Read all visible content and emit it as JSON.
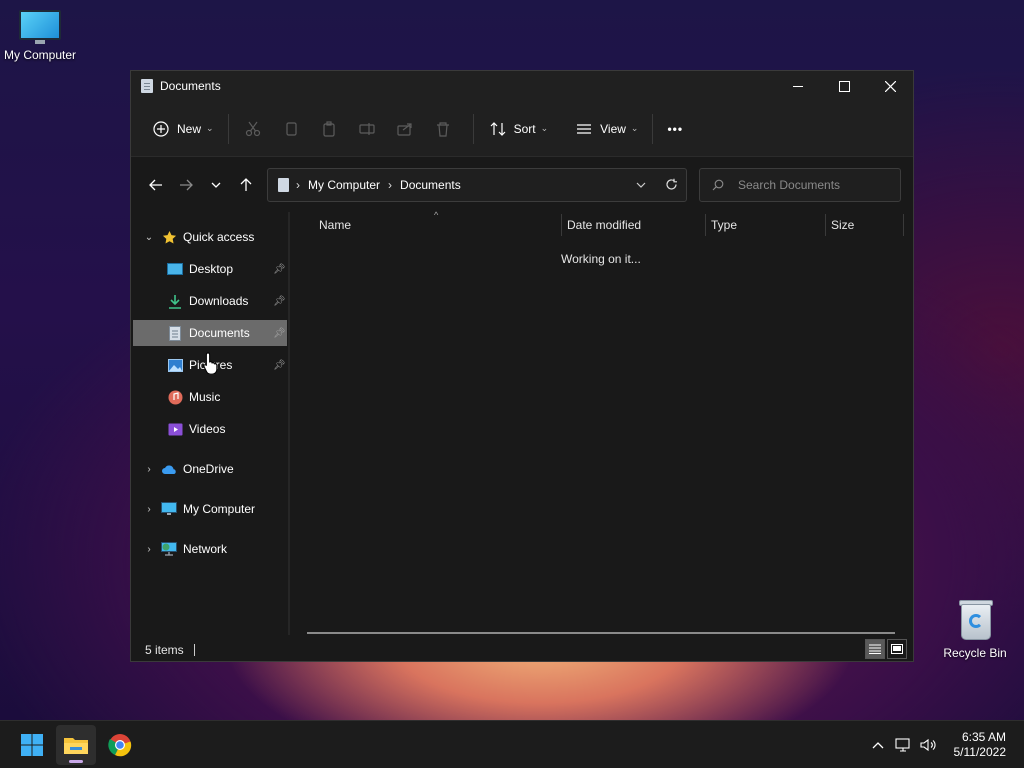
{
  "desktop": {
    "icons": [
      {
        "label": "My Computer"
      },
      {
        "label": "Recycle Bin"
      }
    ]
  },
  "window": {
    "title": "Documents",
    "toolbar": {
      "new_label": "New",
      "sort_label": "Sort",
      "view_label": "View",
      "more_label": "•••"
    },
    "address": {
      "segments": [
        "My Computer",
        "Documents"
      ],
      "search_placeholder": "Search Documents"
    },
    "sidebar": {
      "quick_access": "Quick access",
      "items": [
        {
          "label": "Desktop",
          "pinned": true
        },
        {
          "label": "Downloads",
          "pinned": true
        },
        {
          "label": "Documents",
          "pinned": true,
          "selected": true
        },
        {
          "label": "Pictures",
          "pinned": true
        },
        {
          "label": "Music",
          "pinned": false
        },
        {
          "label": "Videos",
          "pinned": false
        }
      ],
      "roots": [
        "OneDrive",
        "My Computer",
        "Network"
      ]
    },
    "columns": [
      "Name",
      "Date modified",
      "Type",
      "Size"
    ],
    "loading_text": "Working on it...",
    "status": {
      "items_text": "5 items"
    }
  },
  "taskbar": {
    "apps": [
      "start-button",
      "file-explorer",
      "chrome"
    ],
    "clock": {
      "time": "6:35 AM",
      "date": "5/11/2022"
    }
  }
}
